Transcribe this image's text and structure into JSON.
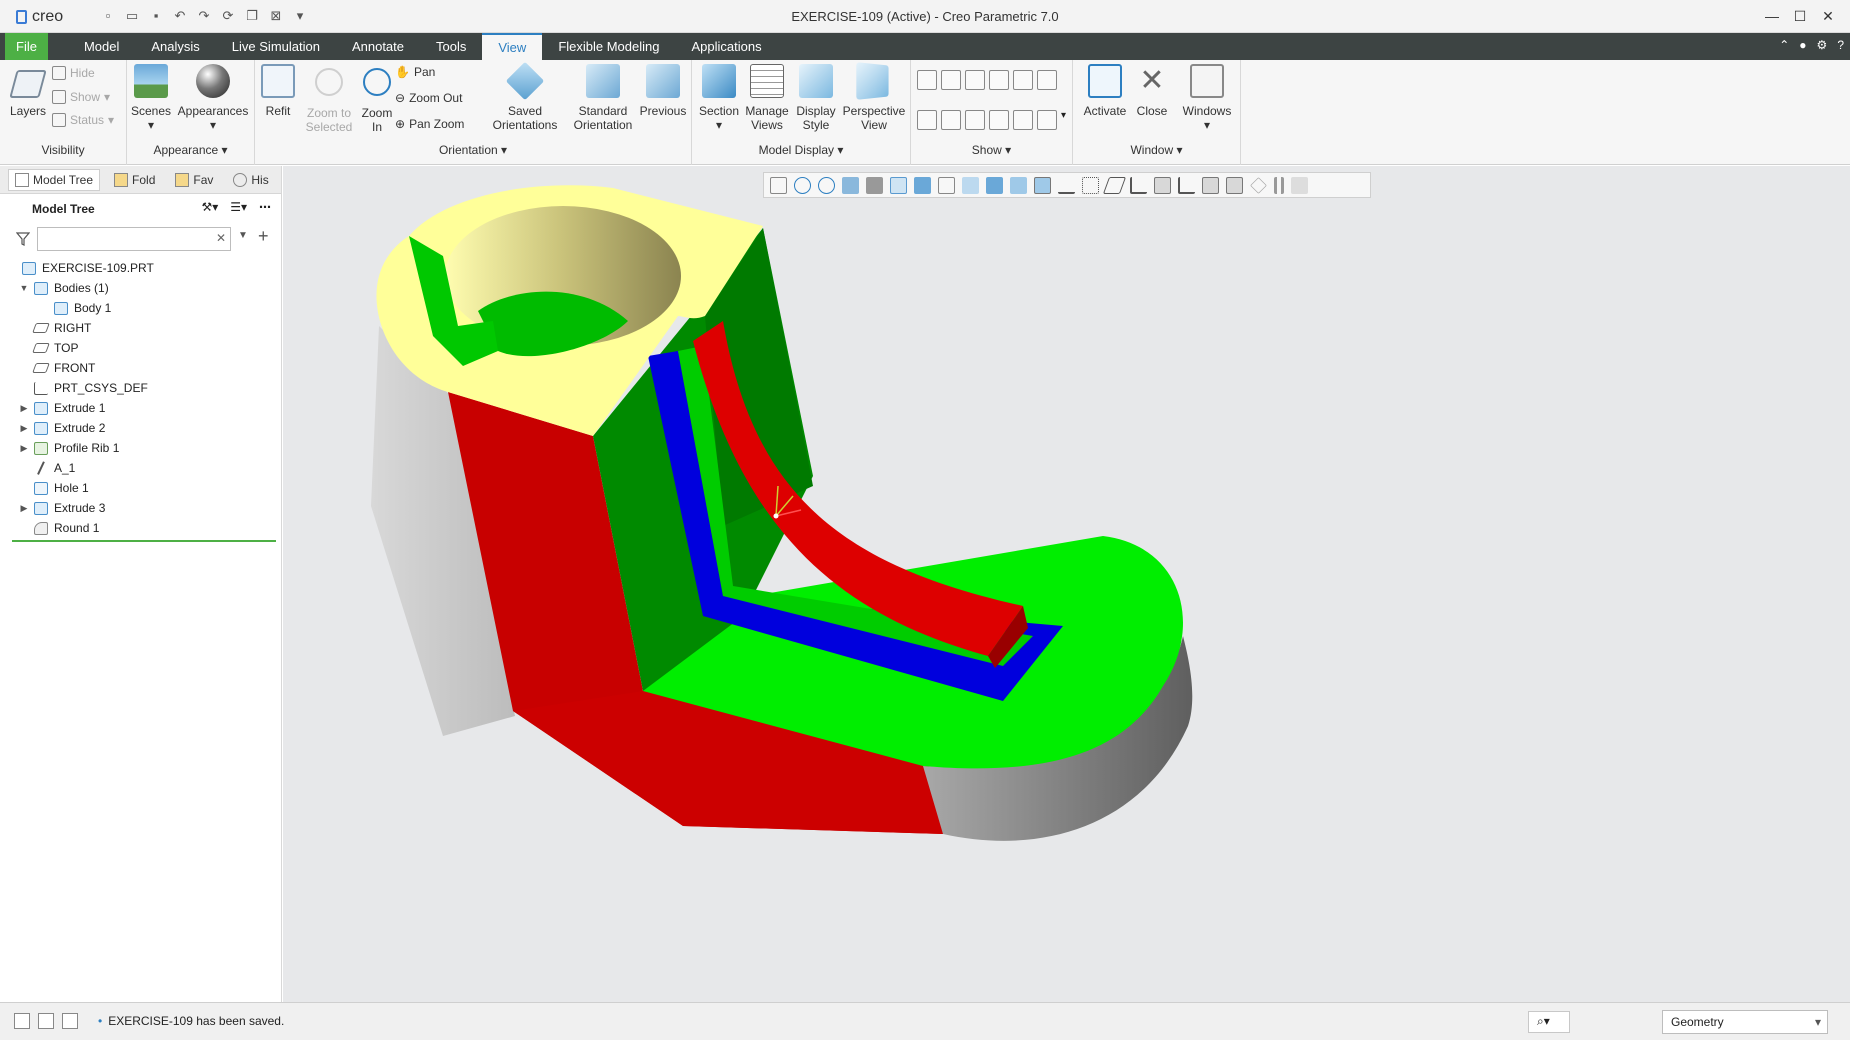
{
  "app": {
    "window_title": "EXERCISE-109 (Active) - Creo Parametric 7.0",
    "logo_text": "creo"
  },
  "tabs": [
    {
      "label": "File"
    },
    {
      "label": "Model"
    },
    {
      "label": "Analysis"
    },
    {
      "label": "Live Simulation"
    },
    {
      "label": "Annotate"
    },
    {
      "label": "Tools"
    },
    {
      "label": "View",
      "active": true
    },
    {
      "label": "Flexible Modeling"
    },
    {
      "label": "Applications"
    }
  ],
  "ribbon": {
    "visibility": {
      "label": "Visibility",
      "layers": "Layers",
      "hide": "Hide",
      "show": "Show",
      "status": "Status"
    },
    "appearance": {
      "label": "Appearance",
      "scenes": "Scenes",
      "appearances": "Appearances"
    },
    "orientation": {
      "label": "Orientation",
      "refit": "Refit",
      "zoom_to_selected": "Zoom to Selected",
      "zoom_in": "Zoom In",
      "pan": "Pan",
      "zoom_out": "Zoom Out",
      "pan_zoom": "Pan Zoom",
      "saved_orientations": "Saved Orientations",
      "standard_orientation": "Standard Orientation",
      "previous": "Previous"
    },
    "model_display": {
      "label": "Model Display",
      "section": "Section",
      "manage_views": "Manage Views",
      "display_style": "Display Style",
      "perspective_view": "Perspective View"
    },
    "show": {
      "label": "Show"
    },
    "window": {
      "label": "Window",
      "activate": "Activate",
      "close": "Close",
      "windows": "Windows"
    }
  },
  "panel": {
    "tabs": [
      "Model Tree",
      "Fold",
      "Fav",
      "His"
    ],
    "tree_title": "Model Tree",
    "filter_placeholder": "",
    "items": [
      {
        "label": "EXERCISE-109.PRT",
        "indent": 0,
        "icon": "part-icon",
        "expander": ""
      },
      {
        "label": "Bodies (1)",
        "indent": 1,
        "icon": "bodies-icon",
        "expander": "▼"
      },
      {
        "label": "Body 1",
        "indent": 2,
        "icon": "body-icon",
        "expander": ""
      },
      {
        "label": "RIGHT",
        "indent": 1,
        "icon": "datum-plane-icon",
        "expander": ""
      },
      {
        "label": "TOP",
        "indent": 1,
        "icon": "datum-plane-icon",
        "expander": ""
      },
      {
        "label": "FRONT",
        "indent": 1,
        "icon": "datum-plane-icon",
        "expander": ""
      },
      {
        "label": "PRT_CSYS_DEF",
        "indent": 1,
        "icon": "csys-icon",
        "expander": ""
      },
      {
        "label": "Extrude 1",
        "indent": 1,
        "icon": "extrude-icon",
        "expander": "▶"
      },
      {
        "label": "Extrude 2",
        "indent": 1,
        "icon": "extrude-icon",
        "expander": "▶"
      },
      {
        "label": "Profile Rib 1",
        "indent": 1,
        "icon": "rib-icon",
        "expander": "▶"
      },
      {
        "label": "A_1",
        "indent": 1,
        "icon": "axis-icon",
        "expander": ""
      },
      {
        "label": "Hole 1",
        "indent": 1,
        "icon": "hole-icon",
        "expander": ""
      },
      {
        "label": "Extrude 3",
        "indent": 1,
        "icon": "extrude-icon",
        "expander": "▶"
      },
      {
        "label": "Round 1",
        "indent": 1,
        "icon": "round-icon",
        "expander": ""
      }
    ]
  },
  "status": {
    "message": "EXERCISE-109 has been saved.",
    "selection_filter": "Geometry"
  },
  "colors": {
    "accent": "#2d7fc1",
    "file_tab": "#4db045",
    "tab_bar": "#3d4443",
    "model_yellow": "#ffff99",
    "model_red": "#cc0000",
    "model_green": "#00ee00",
    "model_dark_green": "#008a00",
    "model_blue": "#0000dd",
    "model_grey": "#bfbfbf",
    "background": "#e7e8ea"
  }
}
